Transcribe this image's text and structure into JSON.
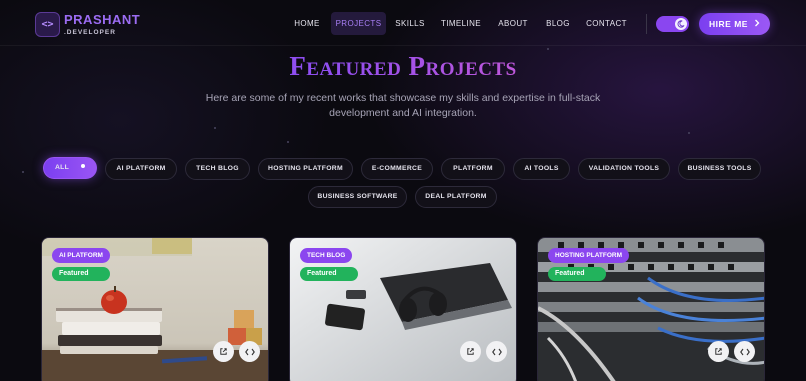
{
  "brand": {
    "name": "PRASHANT",
    "sub": ".DEVELOPER",
    "logo_glyph": "<>"
  },
  "nav": {
    "items": [
      {
        "label": "HOME",
        "active": false
      },
      {
        "label": "PROJECTS",
        "active": true
      },
      {
        "label": "SKILLS",
        "active": false
      },
      {
        "label": "TIMELINE",
        "active": false
      },
      {
        "label": "ABOUT",
        "active": false
      },
      {
        "label": "BLOG",
        "active": false
      },
      {
        "label": "CONTACT",
        "active": false
      }
    ],
    "theme_toggle_icon": "moon-icon",
    "hire_label": "HIRE ME",
    "hire_icon": "chevron-right-icon"
  },
  "header": {
    "title": "Featured Projects",
    "subtitle": "Here are some of my recent works that showcase my skills and expertise in full-stack development and AI integration."
  },
  "filters": [
    {
      "label": "ALL",
      "active": true
    },
    {
      "label": "AI PLATFORM"
    },
    {
      "label": "TECH BLOG"
    },
    {
      "label": "HOSTING PLATFORM"
    },
    {
      "label": "E-COMMERCE"
    },
    {
      "label": "PLATFORM"
    },
    {
      "label": "AI TOOLS"
    },
    {
      "label": "VALIDATION TOOLS"
    },
    {
      "label": "BUSINESS TOOLS"
    },
    {
      "label": "BUSINESS SOFTWARE"
    },
    {
      "label": "DEAL PLATFORM"
    }
  ],
  "cards": [
    {
      "category": "AI PLATFORM",
      "featured": "Featured",
      "image": "apple-books-blocks-image",
      "actions": [
        "external-link-icon",
        "code-icon"
      ]
    },
    {
      "category": "TECH BLOG",
      "featured": "Featured",
      "image": "headphones-laptop-phone-image",
      "actions": [
        "external-link-icon",
        "code-icon"
      ]
    },
    {
      "category": "HOSTING PLATFORM",
      "featured": "Featured",
      "image": "server-rack-cables-image",
      "actions": [
        "external-link-icon",
        "code-icon"
      ]
    }
  ],
  "colors": {
    "accent": "#8b46ef",
    "accent_pink": "#d35bd0",
    "featured_green": "#22b35c",
    "background": "#0b0a10"
  }
}
